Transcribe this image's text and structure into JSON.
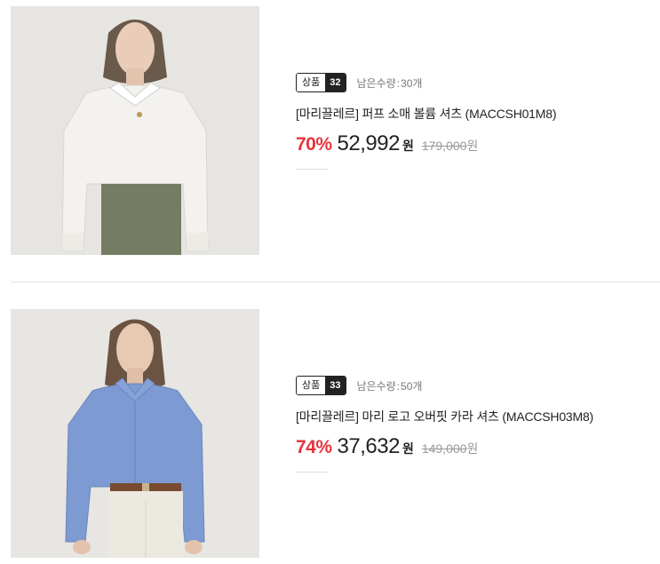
{
  "products": [
    {
      "badge_label": "상품",
      "badge_number": "32",
      "remaining_label": "남은수량",
      "remaining_sep": ":",
      "remaining_value": "30개",
      "title": "[마리끌레르] 퍼프 소매 볼륨 셔츠 (MACCSH01M8)",
      "discount_rate": "70%",
      "sale_price": "52,992",
      "sale_unit": "원",
      "original_price": "179,000",
      "original_unit": "원",
      "image_icon": "model-white-shirt-photo",
      "shirt_color": "#f3f2ee",
      "bottom_color": "#747c63"
    },
    {
      "badge_label": "상품",
      "badge_number": "33",
      "remaining_label": "남은수량",
      "remaining_sep": ":",
      "remaining_value": "50개",
      "title": "[마리끌레르] 마리 로고 오버핏 카라 셔츠 (MACCSH03M8)",
      "discount_rate": "74%",
      "sale_price": "37,632",
      "sale_unit": "원",
      "original_price": "149,000",
      "original_unit": "원",
      "image_icon": "model-blue-shirt-photo",
      "shirt_color": "#7d9ad2",
      "bottom_color": "#ece9e1"
    }
  ],
  "colors": {
    "discount": "#e8333c",
    "text": "#222222",
    "muted": "#999999",
    "divider": "#e5e5e5"
  }
}
